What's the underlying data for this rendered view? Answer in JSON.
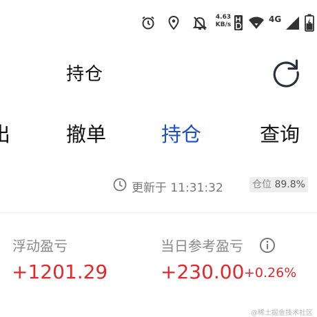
{
  "status_bar": {
    "speed_value": "4.63",
    "speed_unit": "KB/s",
    "network": "4G",
    "icons": [
      "alarm-icon",
      "location-icon",
      "notifications-off-icon",
      "hd-icon",
      "wifi-icon",
      "signal-icon",
      "battery-charging-icon"
    ]
  },
  "header": {
    "title": "持仓",
    "refresh_icon": "refresh-icon"
  },
  "tabs": [
    {
      "label": "出",
      "active": false
    },
    {
      "label": "撤单",
      "active": false
    },
    {
      "label": "持仓",
      "active": true
    },
    {
      "label": "查询",
      "active": false
    }
  ],
  "update": {
    "text": "更新于 11:31:32",
    "position_label": "仓位",
    "position_value": "89.8%"
  },
  "pnl": {
    "floating_label": "浮动盈亏",
    "floating_value": "+1201.29",
    "daily_label": "当日参考盈亏",
    "daily_value": "+230.00",
    "daily_pct": "+0.26%"
  },
  "watermark": "@稀土掘金技术社区",
  "colors": {
    "accent": "#1a4fc9",
    "profit": "#e0282d",
    "muted": "#888888"
  }
}
